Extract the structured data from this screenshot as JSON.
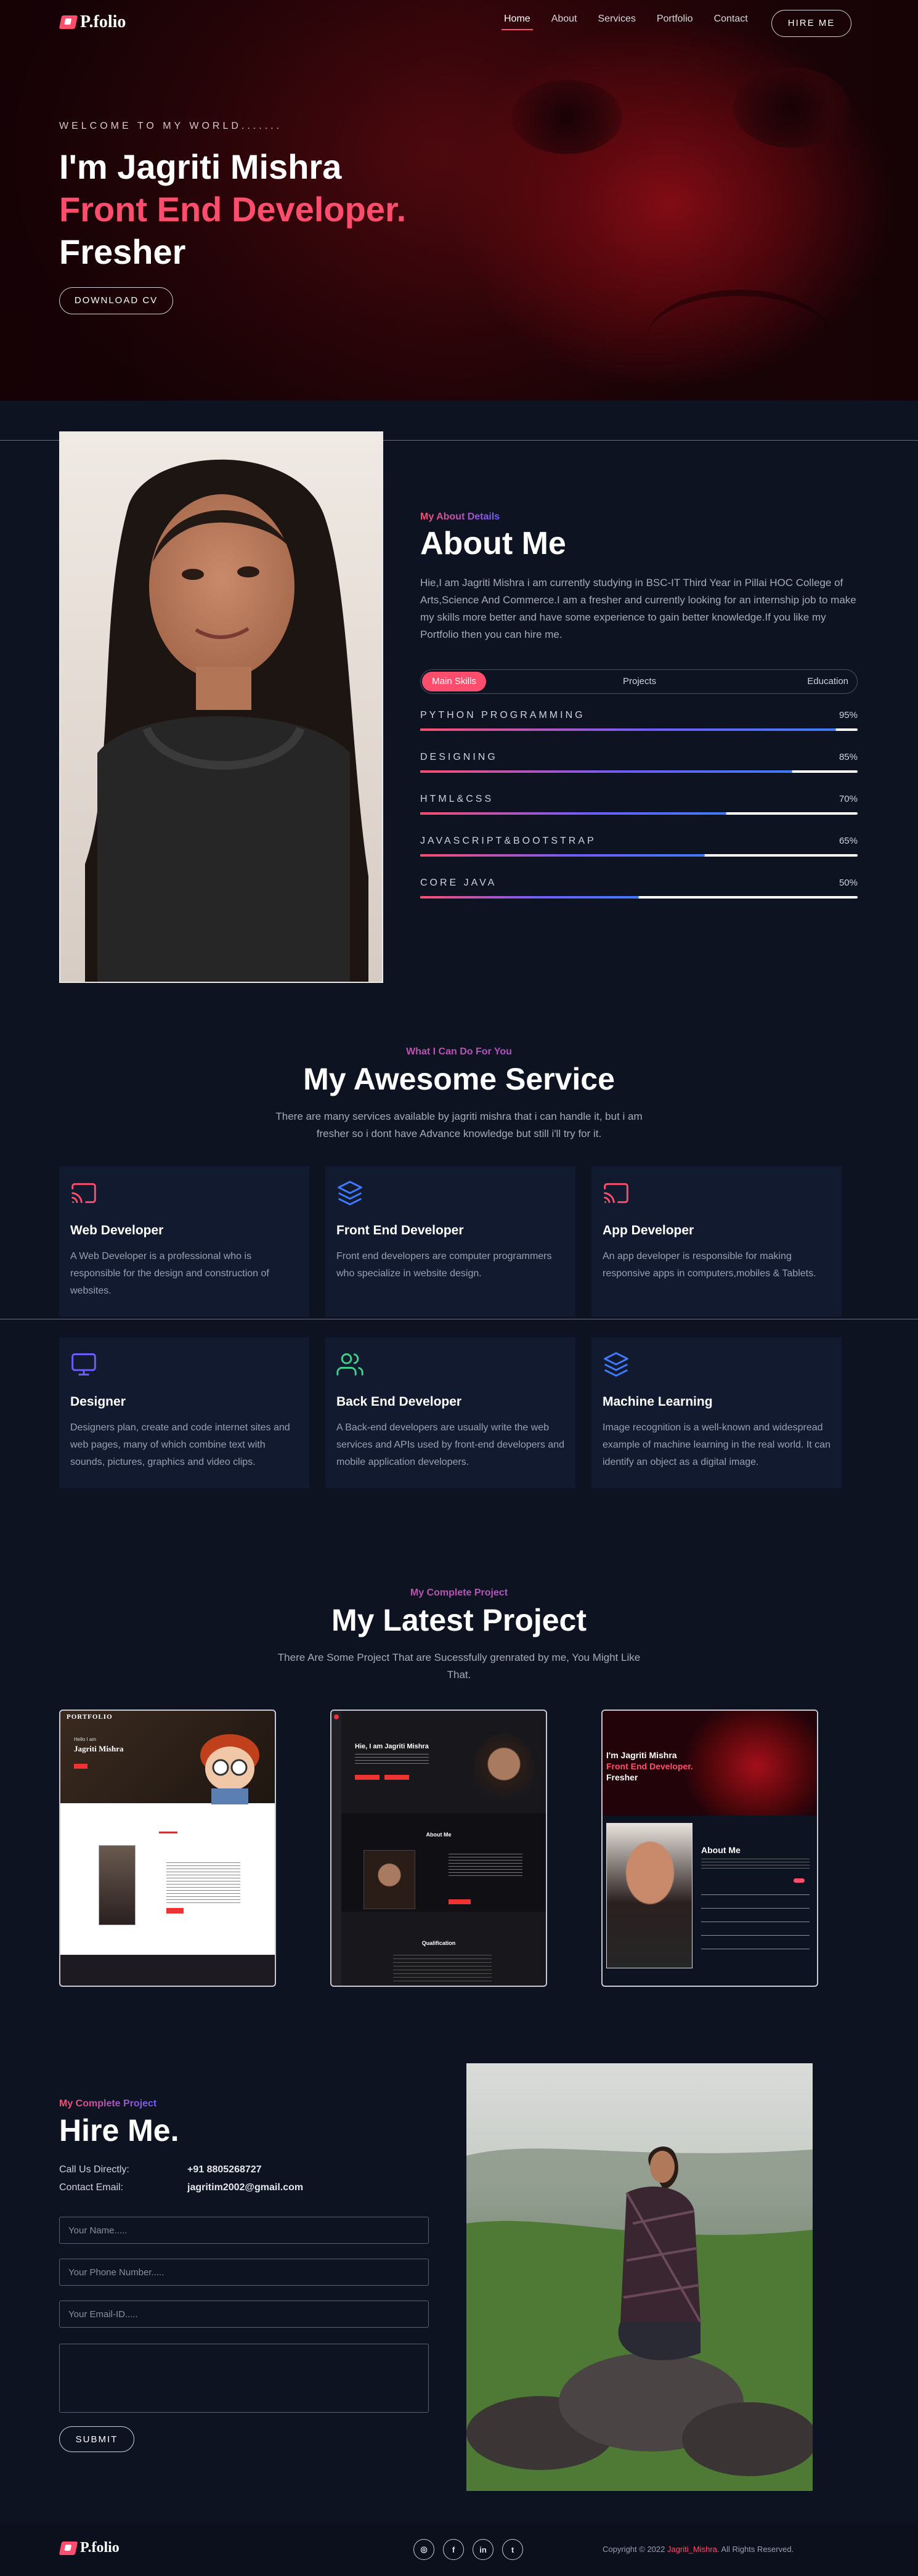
{
  "brand": {
    "logo_text": "P.folio"
  },
  "nav": {
    "items": [
      "Home",
      "About",
      "Services",
      "Portfolio",
      "Contact"
    ],
    "active": "Home",
    "hire_button": "HIRE ME"
  },
  "hero": {
    "welcome": "WELCOME TO MY WORLD.......",
    "name_line": "I'm Jagriti Mishra",
    "role_line": "Front End Developer.",
    "status_line": "Fresher",
    "cv_button": "DOWNLOAD CV"
  },
  "about": {
    "kicker": "My About Details",
    "title": "About Me",
    "text": "Hie,I am Jagriti Mishra i am currently studying in BSC-IT Third Year in Pillai HOC College of Arts,Science And Commerce.I am a fresher and currently looking for an internship job to make my skills more better and have some experience to gain better knowledge.If you like my Portfolio then you can hire me.",
    "tabs": [
      "Main Skills",
      "Projects",
      "Education"
    ],
    "skills": [
      {
        "name": "PYTHON PROGRAMMING",
        "percent_label": "95%",
        "level": 0.95
      },
      {
        "name": "DESIGNING",
        "percent_label": "85%",
        "level": 0.85
      },
      {
        "name": "HTML&CSS",
        "percent_label": "70%",
        "level": 0.7
      },
      {
        "name": "JAVASCRIPT&BOOTSTRAP",
        "percent_label": "65%",
        "level": 0.65
      },
      {
        "name": "CORE JAVA",
        "percent_label": "50%",
        "level": 0.5
      }
    ]
  },
  "services": {
    "kicker": "What I Can Do For You",
    "title": "My Awesome Service",
    "subtitle": "There are many services available by jagriti mishra that i can handle it, but i am fresher so i dont have Advance knowledge but still i'll try for it.",
    "cards": [
      {
        "icon": "cast-icon",
        "title": "Web Developer",
        "desc": "A Web Developer is a professional who is responsible for the design and construction of websites."
      },
      {
        "icon": "layers-icon",
        "title": "Front End Developer",
        "desc": "Front end developers are computer programmers who specialize in website design."
      },
      {
        "icon": "cast-icon",
        "title": "App Developer",
        "desc": "An app developer is responsible for making responsive apps in computers,mobiles & Tablets."
      },
      {
        "icon": "monitor-icon",
        "title": "Designer",
        "desc": "Designers plan, create and code internet sites and web pages, many of which combine text with sounds, pictures, graphics and video clips."
      },
      {
        "icon": "users-icon",
        "title": "Back End Developer",
        "desc": "A Back-end developers are usually write the web services and APIs used by front-end developers and mobile application developers."
      },
      {
        "icon": "layers-icon",
        "title": "Machine Learning",
        "desc": "Image recognition is a well-known and widespread example of machine learning in the real world. It can identify an object as a digital image."
      }
    ]
  },
  "projects": {
    "kicker": "My Complete Project",
    "title": "My Latest Project",
    "subtitle": "There Are Some Project That are Sucessfully grenrated by me, You Might Like That.",
    "thumbs": {
      "p1_brand": "PORTFOLIO",
      "p1_hello": "Hello I am",
      "p1_name": "Jagriti Mishra",
      "p2_heading": "Hie, I am Jagriti Mishra",
      "p2_about": "About Me",
      "p2_qual": "Qualification",
      "p3_name": "I'm Jagriti Mishra",
      "p3_role": "Front End Developer.",
      "p3_status": "Fresher",
      "p3_about": "About Me"
    }
  },
  "hire": {
    "kicker": "My Complete Project",
    "title": "Hire Me.",
    "phone_label": "Call Us Directly:",
    "phone_value": "+91 8805268727",
    "email_label": "Contact Email:",
    "email_value": "jagritim2002@gmail.com",
    "name_placeholder": "Your Name.....",
    "phone_placeholder": "Your Phone Number.....",
    "email_placeholder": "Your Email-ID.....",
    "message_placeholder": "",
    "submit": "SUBMIT"
  },
  "footer": {
    "logo_text": "P.folio",
    "social": [
      {
        "icon": "instagram-icon",
        "glyph": "◎"
      },
      {
        "icon": "facebook-icon",
        "glyph": "f"
      },
      {
        "icon": "linkedin-icon",
        "glyph": "in"
      },
      {
        "icon": "twitter-icon",
        "glyph": "t"
      }
    ],
    "copyright_prefix": "Copyright © 2022",
    "copyright_name": "Jagriti_Mishra",
    "copyright_suffix": ". All Rights Reserved."
  },
  "colors": {
    "accent": "#ff4d6d",
    "accent2": "#6e5cff",
    "background": "#0e1322",
    "card": "#111a2e"
  }
}
